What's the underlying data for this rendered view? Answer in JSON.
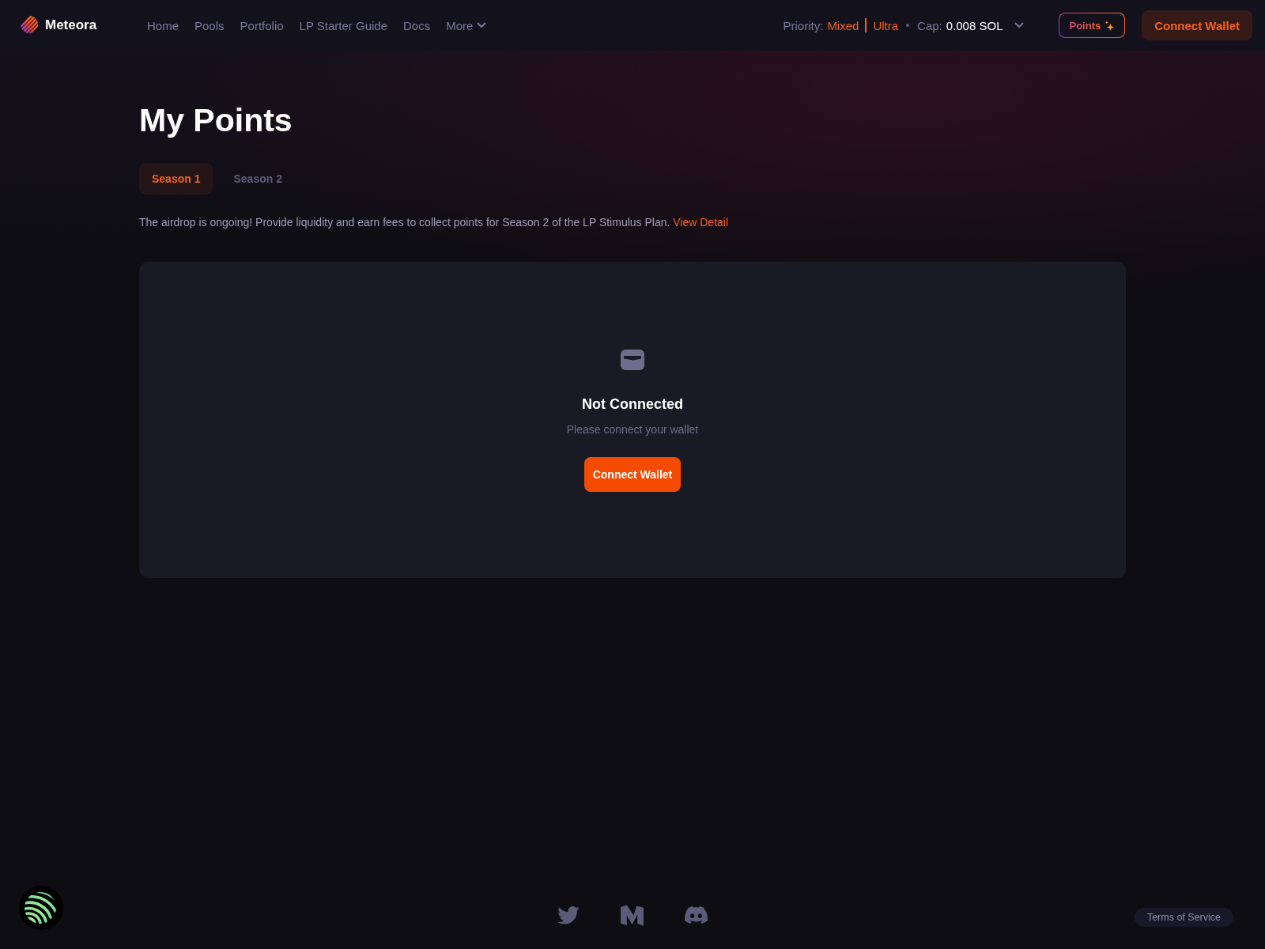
{
  "nav": {
    "brand": "Meteora",
    "links": [
      {
        "label": "Home",
        "kind": "link"
      },
      {
        "label": "Pools",
        "kind": "link"
      },
      {
        "label": "Portfolio",
        "kind": "link"
      },
      {
        "label": "LP Starter Guide",
        "kind": "link"
      },
      {
        "label": "Docs",
        "kind": "link"
      },
      {
        "label": "More",
        "kind": "dropdown"
      }
    ],
    "priority": {
      "label": "Priority:",
      "mode": "Mixed",
      "level": "Ultra",
      "cap_label": "Cap:",
      "cap_value": "0.008 SOL"
    },
    "points_button": "Points",
    "connect_button": "Connect Wallet"
  },
  "page": {
    "title": "My Points",
    "tabs": [
      {
        "label": "Season 1",
        "selected": true
      },
      {
        "label": "Season 2",
        "selected": false
      }
    ],
    "notice": {
      "text": "The airdrop is ongoing! Provide liquidity and earn fees to collect points for Season 2 of the LP Stimulus Plan.",
      "link": "View Detail"
    }
  },
  "empty_state": {
    "title": "Not Connected",
    "message": "Please connect your wallet",
    "button": "Connect Wallet"
  },
  "footer": {
    "social": [
      {
        "kind": "twitter"
      },
      {
        "kind": "medium"
      },
      {
        "kind": "discord"
      }
    ],
    "terms": "Terms of Service"
  }
}
